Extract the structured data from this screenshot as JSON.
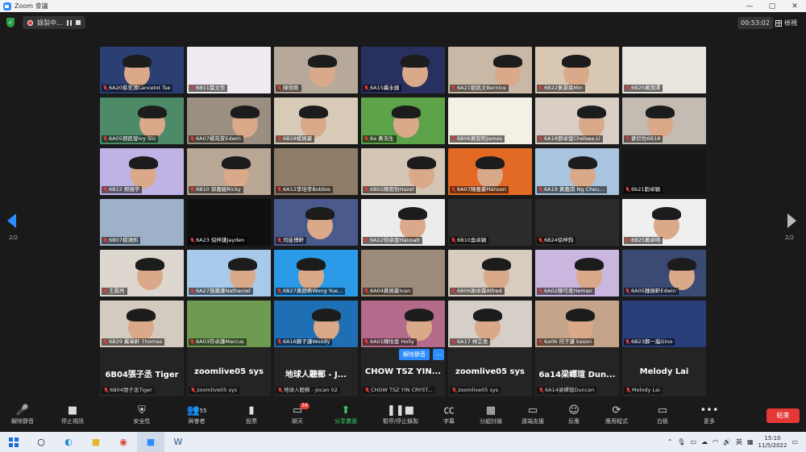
{
  "window": {
    "title": "Zoom 會議"
  },
  "topbar": {
    "recording_label": "錄製中...",
    "timer": "00:53:02",
    "view_label": "檢視"
  },
  "pagination": {
    "left": "2/2",
    "right": "2/2"
  },
  "tiles": [
    {
      "label": "6A20蔡至源Lancelot Tse",
      "bg": "#2b3f73"
    },
    {
      "label": "6B11葉文哲",
      "bg": "#efe9f1"
    },
    {
      "label": "陳德剛",
      "bg": "#b7a999"
    },
    {
      "label": "6A15冀永鏈",
      "bg": "#28305f"
    },
    {
      "label": "6A21劉凱文Bernice",
      "bg": "#c9b8a6"
    },
    {
      "label": "6B22黃灏萊Min",
      "bg": "#d8c7b3"
    },
    {
      "label": "6B20黃潤澤",
      "bg": "#e8e4de"
    },
    {
      "label": "6A05鄧凱瑩Ivy Siu",
      "bg": "#4d8a68"
    },
    {
      "label": "6A07楊苑萱Edwin",
      "bg": "#9a8f80"
    },
    {
      "label": "6B28楊展豪",
      "bg": "#d7cbb8"
    },
    {
      "label": "6a 黃浩生",
      "bg": "#5da34a"
    },
    {
      "label": "6B06黃智熙James",
      "bg": "#f5f0e6"
    },
    {
      "label": "6A18鄧卓瑩Chelsea Li",
      "bg": "#d9cfc4"
    },
    {
      "label": "麥欣怡6B18",
      "bg": "#c4bcb2"
    },
    {
      "label": "6B12 邢振宇",
      "bg": "#bfb3e6"
    },
    {
      "label": "6B10 郭嘉駿Ricky",
      "bg": "#b8a795"
    },
    {
      "label": "6A12李培孝Bobbie",
      "bg": "#8e7c66"
    },
    {
      "label": "6B02陳雨怡Hazel",
      "bg": "#d4c6b4"
    },
    {
      "label": "6A07陳嘉豪Hanson",
      "bg": "#e26a25"
    },
    {
      "label": "6A19 黃嘉琪 Ng Cheu...",
      "bg": "#a8c4de"
    },
    {
      "label": "6b21劉卓穎",
      "bg": "#161616"
    },
    {
      "label": "6B07楊鴻熙",
      "bg": "#9db2c9"
    },
    {
      "label": "6A23 倪梓謙Jayden",
      "bg": "#0f0f0f"
    },
    {
      "label": "司徒博軒",
      "bg": "#4a5a8c"
    },
    {
      "label": "6A12何卓恩Hannah",
      "bg": "#ececec"
    },
    {
      "label": "6B10吳卓穎",
      "bg": "#2b2b2b"
    },
    {
      "label": "6B24徐梓鈞",
      "bg": "#2a2a2a"
    },
    {
      "label": "6B25黃卓明",
      "bg": "#efefef"
    },
    {
      "label": "王鼎亮",
      "bg": "#ddd7cf"
    },
    {
      "label": "6A27施騰謙Nathaniel",
      "bg": "#a7c9ea"
    },
    {
      "label": "6B27黃朗希Wong Yue...",
      "bg": "#2b9ae8"
    },
    {
      "label": "6A04黃展豪Ivan",
      "bg": "#9c8b78"
    },
    {
      "label": "6B06謝卓霖Alfred",
      "bg": "#d8cbbf"
    },
    {
      "label": "6A02陳可柔Heman",
      "bg": "#c9b7e0"
    },
    {
      "label": "6A05鍾展軒Edwin",
      "bg": "#3b4a73"
    },
    {
      "label": "6B29 冀韋軒 Thomas",
      "bg": "#d4cbc0"
    },
    {
      "label": "6A03符卓謙Marcus",
      "bg": "#6e9a52"
    },
    {
      "label": "6A16鄭子謙Woody",
      "bg": "#1f6fb5"
    },
    {
      "label": "6A01陳怡恩 Holly",
      "bg": "#b46a8a"
    },
    {
      "label": "6A17 林芷柔",
      "bg": "#d6cfc8"
    },
    {
      "label": "6a06 何子謙 kason",
      "bg": "#c4a48a"
    },
    {
      "label": "6B23鄭一嵐Gino",
      "bg": "#2a3e7a"
    }
  ],
  "name_tiles": [
    {
      "name": "6B04張子丞 Tiger",
      "label": "6B04張子丞Tiger"
    },
    {
      "name": "zoomlive05 sys",
      "label": "zoomlive05 sys"
    },
    {
      "name": "地球人聽郵 - J...",
      "label": "地球人聽郵 - Jocan 02"
    },
    {
      "name": "CHOW TSZ YIN...",
      "label": "CHOW TSZ YIN CRYST..."
    },
    {
      "name": "zoomlive05 sys",
      "label": "zoomlive05 sys"
    },
    {
      "name": "6a14梁嶧瑄 Dun...",
      "label": "6A14梁嶧瑄Duncan"
    },
    {
      "name": "Melody Lai",
      "label": "Melody Lai"
    }
  ],
  "tile_actions": {
    "unmute": "解除靜音",
    "more": "..."
  },
  "toolbar": {
    "unmute": "解除靜音",
    "stop_video": "停止視訊",
    "security": "安全性",
    "participants": "與會者",
    "participants_count": "55",
    "polls": "投票",
    "chat": "聊天",
    "chat_badge": "34",
    "share": "分享畫面",
    "pause_record": "暫停/停止錄製",
    "captions": "字幕",
    "breakout": "分組討論",
    "remote": "遠端支援",
    "reactions": "反應",
    "apps": "應用程式",
    "whiteboard": "白板",
    "more": "更多",
    "end": "結束"
  },
  "taskbar": {
    "ime": "英",
    "time": "15:10",
    "date": "11/5/2022"
  }
}
